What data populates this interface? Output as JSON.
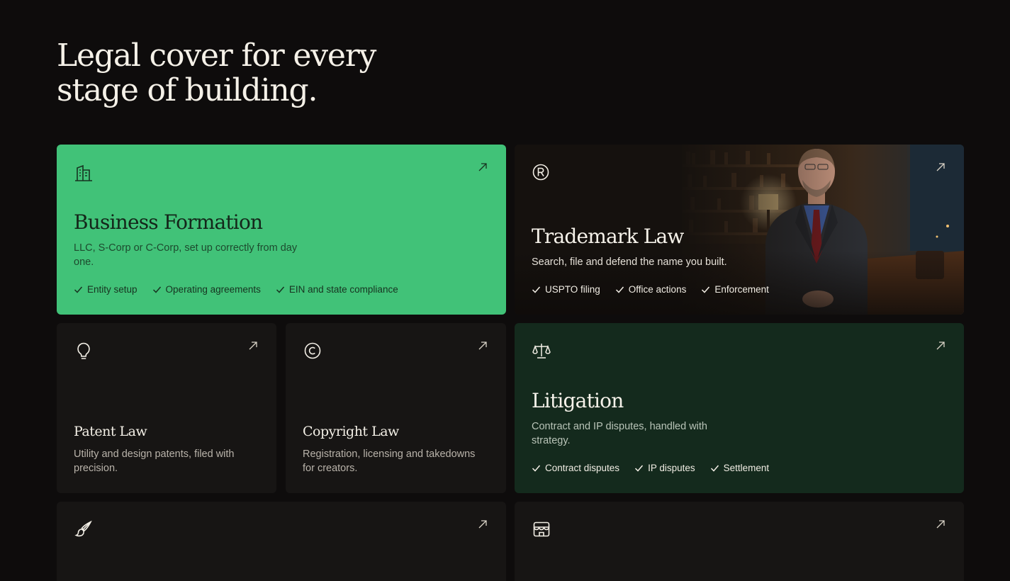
{
  "headline": {
    "line1": "Legal cover for every",
    "line2": "stage of building."
  },
  "colors": {
    "background": "#0e0c0c",
    "accent_green": "#41c278",
    "deep_green": "#142a1d",
    "card_dark": "#171514"
  },
  "cards": {
    "business": {
      "icon": "building-icon",
      "title": "Business Formation",
      "description": "LLC, S-Corp or C-Corp, set up correctly from day one.",
      "checks": [
        "Entity setup",
        "Operating agreements",
        "EIN and state compliance"
      ]
    },
    "trademark": {
      "icon": "registered-icon",
      "title": "Trademark Law",
      "description": "Search, file and defend the name you built.",
      "checks": [
        "USPTO filing",
        "Office actions",
        "Enforcement"
      ]
    },
    "patent": {
      "icon": "lightbulb-icon",
      "title": "Patent Law",
      "description": "Utility and design patents, filed with precision."
    },
    "copyright": {
      "icon": "copyright-icon",
      "title": "Copyright Law",
      "description": "Registration, licensing and takedowns for creators."
    },
    "litigation": {
      "icon": "scales-icon",
      "title": "Litigation",
      "description": "Contract and IP disputes, handled with strategy.",
      "checks": [
        "Contract disputes",
        "IP disputes",
        "Settlement"
      ]
    },
    "brand": {
      "icon": "paintbrush-icon"
    },
    "commerce": {
      "icon": "storefront-icon"
    }
  }
}
